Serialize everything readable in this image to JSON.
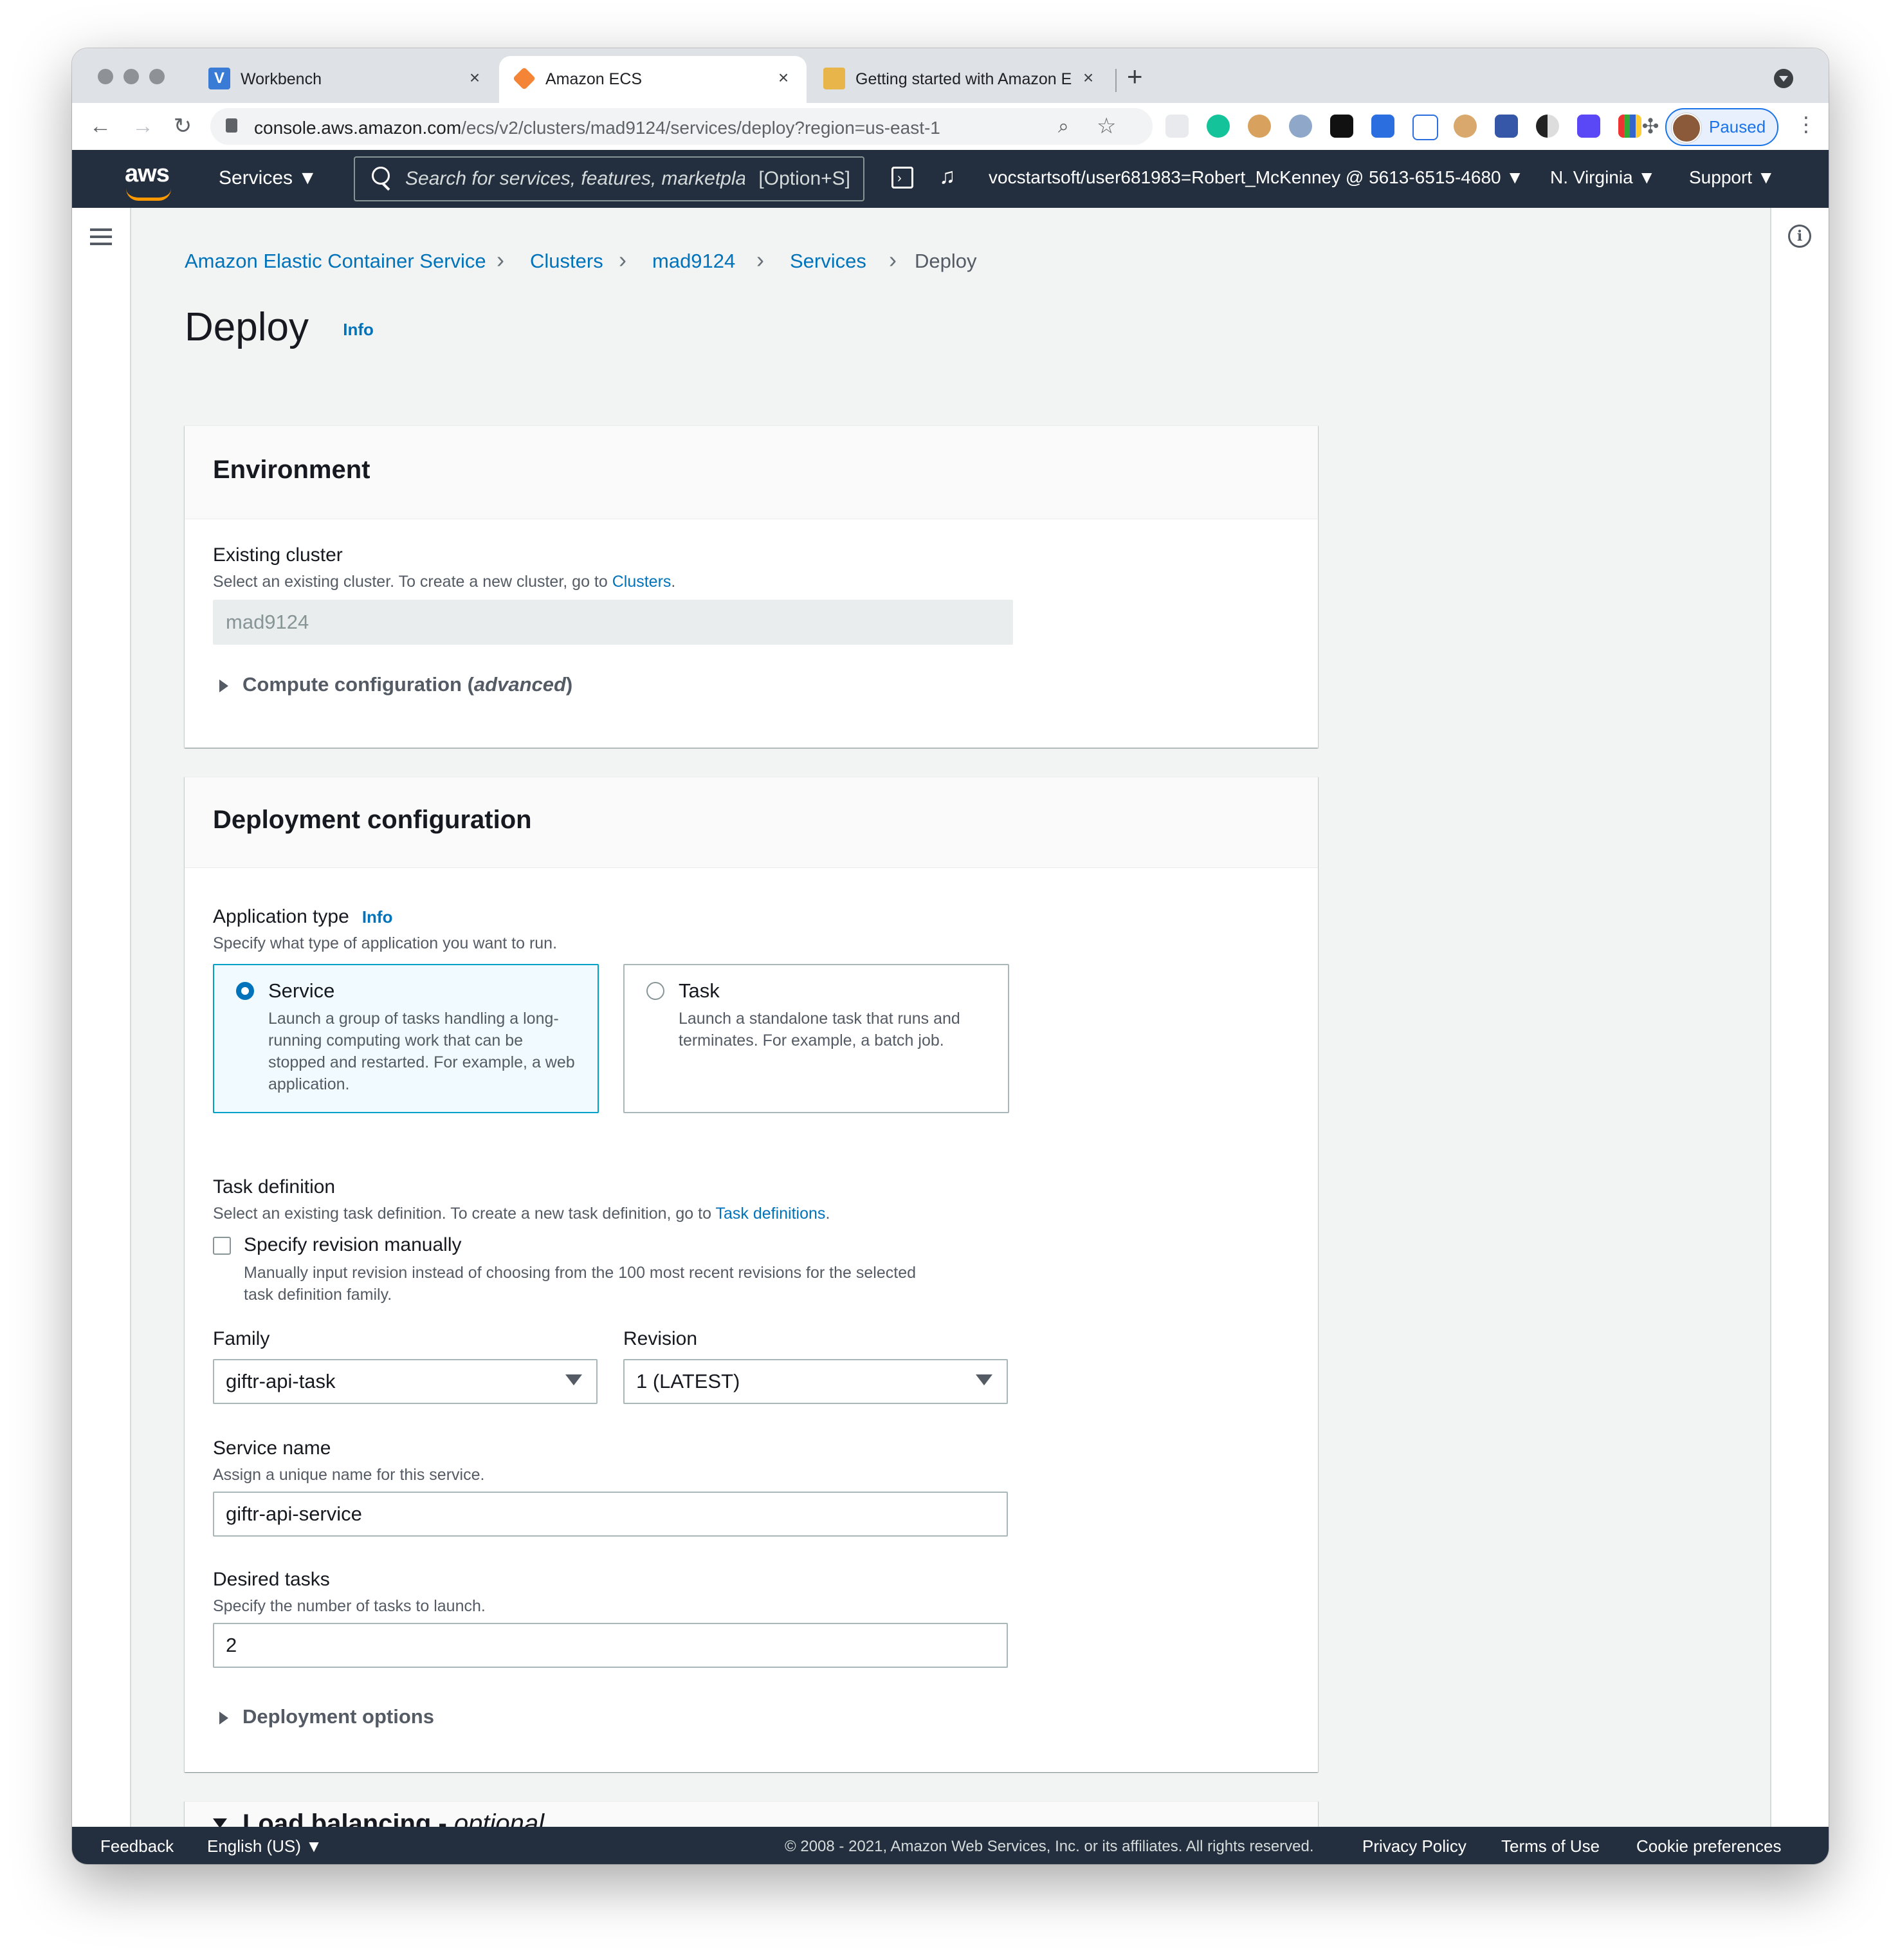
{
  "browser": {
    "tabs": [
      {
        "title": "Workbench",
        "favicon_color": "#1a73e8"
      },
      {
        "title": "Amazon ECS",
        "favicon_color": "#f58536"
      },
      {
        "title": "Getting started with Amazon E",
        "favicon_color": "#e8b54a"
      }
    ],
    "url_host": "console.aws.amazon.com",
    "url_path": "/ecs/v2/clusters/mad9124/services/deploy?region=us-east-1",
    "profile_status": "Paused"
  },
  "aws_nav": {
    "logo": "aws",
    "services_label": "Services",
    "search_placeholder": "Search for services, features, marketplace",
    "search_shortcut": "[Option+S]",
    "account": "vocstartsoft/user681983=Robert_McKenney @ 5613-6515-4680",
    "region": "N. Virginia",
    "support": "Support"
  },
  "breadcrumb": [
    "Amazon Elastic Container Service",
    "Clusters",
    "mad9124",
    "Services",
    "Deploy"
  ],
  "page": {
    "title": "Deploy",
    "info": "Info"
  },
  "environment": {
    "header": "Environment",
    "cluster_label": "Existing cluster",
    "cluster_desc": "Select an existing cluster. To create a new cluster, go to ",
    "cluster_link": "Clusters",
    "cluster_desc_end": ".",
    "cluster_value": "mad9124",
    "compute_expander": "Compute configuration (",
    "compute_expander_italic": "advanced",
    "compute_expander_end": ")"
  },
  "deployment": {
    "header": "Deployment configuration",
    "app_type_label": "Application type",
    "app_type_info": "Info",
    "app_type_desc": "Specify what type of application you want to run.",
    "options": [
      {
        "title": "Service",
        "desc": "Launch a group of tasks handling a long-running computing work that can be stopped and restarted. For example, a web application.",
        "selected": true
      },
      {
        "title": "Task",
        "desc": "Launch a standalone task that runs and terminates. For example, a batch job.",
        "selected": false
      }
    ],
    "task_def_label": "Task definition",
    "task_def_desc": "Select an existing task definition. To create a new task definition, go to ",
    "task_def_link": "Task definitions",
    "task_def_desc_end": ".",
    "manual_label": "Specify revision manually",
    "manual_desc_1": "Manually input revision instead of choosing from the 100 most recent revisions for the selected",
    "manual_desc_2": "task definition family.",
    "family_label": "Family",
    "family_value": "giftr-api-task",
    "revision_label": "Revision",
    "revision_value": "1 (LATEST)",
    "service_name_label": "Service name",
    "service_name_desc": "Assign a unique name for this service.",
    "service_name_value": "giftr-api-service",
    "desired_label": "Desired tasks",
    "desired_desc": "Specify the number of tasks to launch.",
    "desired_value": "2",
    "deploy_options": "Deployment options"
  },
  "load_balancing": {
    "header": "Load balancing - ",
    "header_italic": "optional"
  },
  "footer": {
    "feedback": "Feedback",
    "language": "English (US)",
    "copyright": "© 2008 - 2021, Amazon Web Services, Inc. or its affiliates. All rights reserved.",
    "privacy": "Privacy Policy",
    "terms": "Terms of Use",
    "cookies": "Cookie preferences"
  }
}
